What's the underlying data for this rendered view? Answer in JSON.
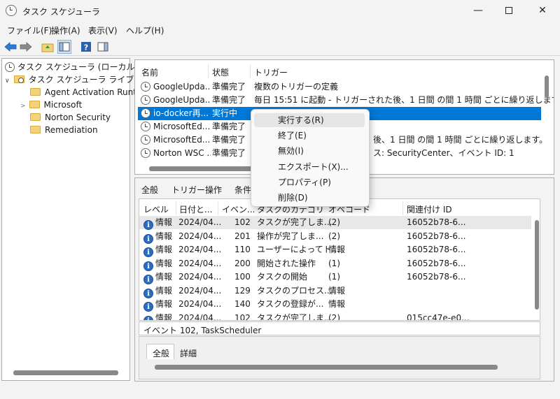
{
  "window": {
    "title": "タスク スケジューラ"
  },
  "menu": [
    "ファイル(F)",
    "操作(A)",
    "表示(V)",
    "ヘルプ(H)"
  ],
  "tree": {
    "root": "タスク スケジューラ (ローカル)",
    "library": "タスク スケジューラ ライブラリ",
    "folders": [
      "Agent Activation Runt",
      "Microsoft",
      "Norton Security",
      "Remediation"
    ]
  },
  "tasks": {
    "headers": [
      "名前",
      "状態",
      "トリガー"
    ],
    "rows": [
      {
        "name": "GoogleUpda...",
        "status": "準備完了",
        "trigger": "複数のトリガーの定義"
      },
      {
        "name": "GoogleUpda...",
        "status": "準備完了",
        "trigger": "毎日 15:51 に起動 - トリガーされた後、1 日間 の間 1 時間 ごとに繰り返します。"
      },
      {
        "name": "io-docker再...",
        "status": "実行中",
        "trigger": ""
      },
      {
        "name": "MicrosoftEd...",
        "status": "準備完了",
        "trigger": ""
      },
      {
        "name": "MicrosoftEd...",
        "status": "準備完了",
        "trigger": "後、1 日間 の間 1 時間 ごとに繰り返します。"
      },
      {
        "name": "Norton WSC ...",
        "status": "準備完了",
        "trigger": "ス: SecurityCenter、イベント ID: 1"
      }
    ]
  },
  "context_menu": [
    "実行する(R)",
    "終了(E)",
    "無効(I)",
    "エクスポート(X)...",
    "プロパティ(P)",
    "削除(D)"
  ],
  "detail_tabs": [
    "全般",
    "トリガー",
    "操作",
    "条件"
  ],
  "history": {
    "headers": [
      "レベル",
      "日付と...",
      "イベン...",
      "タスクのカテゴリ",
      "オペコード",
      "関連付け ID"
    ],
    "rows": [
      {
        "level": "情報",
        "date": "2024/04...",
        "event": "102",
        "category": "タスクが完了しま...",
        "opcode": "(2)",
        "id": "16052b78-6..."
      },
      {
        "level": "情報",
        "date": "2024/04...",
        "event": "201",
        "category": "操作が完了しま...",
        "opcode": "(2)",
        "id": "16052b78-6..."
      },
      {
        "level": "情報",
        "date": "2024/04...",
        "event": "110",
        "category": "ユーザーによってト...",
        "opcode": "情報",
        "id": "16052b78-6..."
      },
      {
        "level": "情報",
        "date": "2024/04...",
        "event": "200",
        "category": "開始された操作",
        "opcode": "(1)",
        "id": "16052b78-6..."
      },
      {
        "level": "情報",
        "date": "2024/04...",
        "event": "100",
        "category": "タスクの開始",
        "opcode": "(1)",
        "id": "16052b78-6..."
      },
      {
        "level": "情報",
        "date": "2024/04...",
        "event": "129",
        "category": "タスクのプロセス...",
        "opcode": "情報",
        "id": ""
      },
      {
        "level": "情報",
        "date": "2024/04...",
        "event": "140",
        "category": "タスクの登録が...",
        "opcode": "情報",
        "id": ""
      },
      {
        "level": "情報",
        "date": "2024/04...",
        "event": "102",
        "category": "タスクが完了しま...",
        "opcode": "(2)",
        "id": "015cc47e-e0..."
      }
    ]
  },
  "event_title": "イベント 102, TaskScheduler",
  "event_tabs": [
    "全般",
    "詳細"
  ],
  "info_icon_glyph": "i",
  "colors": {
    "selection": "#0078d7"
  }
}
